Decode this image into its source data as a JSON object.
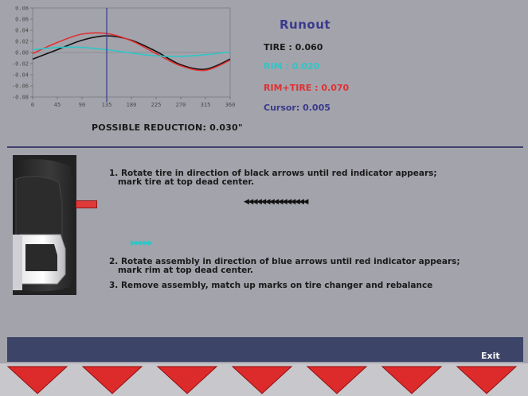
{
  "title": "Runout",
  "readings": {
    "tire": "TIRE : 0.060",
    "rim": "RIM : 0.020",
    "rim_tire": "RIM+TIRE : 0.070",
    "cursor": "Cursor: 0.005"
  },
  "possible_reduction": "POSSIBLE REDUCTION: 0.030\"",
  "instructions": {
    "step1_line1": "1. Rotate tire in direction of black arrows until red indicator appears;",
    "step1_line2": "   mark tire at top dead center.",
    "black_arrows": "◀◀◀◀◀◀◀◀◀◀◀◀◀◀◀",
    "blue_arrows": "▶▶▶▶▶",
    "step2_line1": "2. Rotate assembly in direction of blue arrows until red indicator appears;",
    "step2_line2": "   mark rim at top dead center.",
    "step3": "3. Remove assembly, match up marks on tire changer and rebalance"
  },
  "exit_label": "Exit",
  "softkeys": [
    {
      "icon": "down-triangle-icon"
    },
    {
      "icon": "down-triangle-icon"
    },
    {
      "icon": "down-triangle-icon"
    },
    {
      "icon": "down-triangle-icon"
    },
    {
      "icon": "down-triangle-icon"
    },
    {
      "icon": "down-triangle-icon"
    },
    {
      "icon": "down-triangle-icon"
    }
  ],
  "colors": {
    "tire": "#111111",
    "rim": "#2fc6c6",
    "rim_tire": "#e03030",
    "cursor_line": "#3a3a8c",
    "softkey_arrow": "#dd2a2a"
  },
  "chart_data": {
    "type": "line",
    "x_ticks": [
      "0",
      "45",
      "90",
      "135",
      "180",
      "225",
      "270",
      "315",
      "360"
    ],
    "y_ticks": [
      "0.08",
      "0.06",
      "0.04",
      "0.02",
      "0.00",
      "-0.02",
      "-0.04",
      "-0.06",
      "-0.08"
    ],
    "xlim": [
      0,
      360
    ],
    "ylim": [
      -0.08,
      0.08
    ],
    "cursor_x": 135,
    "series": [
      {
        "color": "#111111",
        "x": [
          0,
          45,
          90,
          135,
          180,
          225,
          270,
          315,
          360
        ],
        "values": [
          -0.012,
          0.005,
          0.022,
          0.03,
          0.022,
          0.002,
          -0.022,
          -0.03,
          -0.012
        ]
      },
      {
        "color": "#e03030",
        "x": [
          0,
          45,
          90,
          135,
          180,
          225,
          270,
          315,
          360
        ],
        "values": [
          -0.002,
          0.018,
          0.033,
          0.034,
          0.021,
          -0.002,
          -0.024,
          -0.032,
          -0.014
        ]
      },
      {
        "color": "#2fc6c6",
        "x": [
          0,
          45,
          90,
          135,
          180,
          225,
          270,
          315,
          360
        ],
        "values": [
          0.005,
          0.009,
          0.009,
          0.005,
          -0.001,
          -0.006,
          -0.007,
          -0.004,
          0.001
        ]
      }
    ]
  }
}
